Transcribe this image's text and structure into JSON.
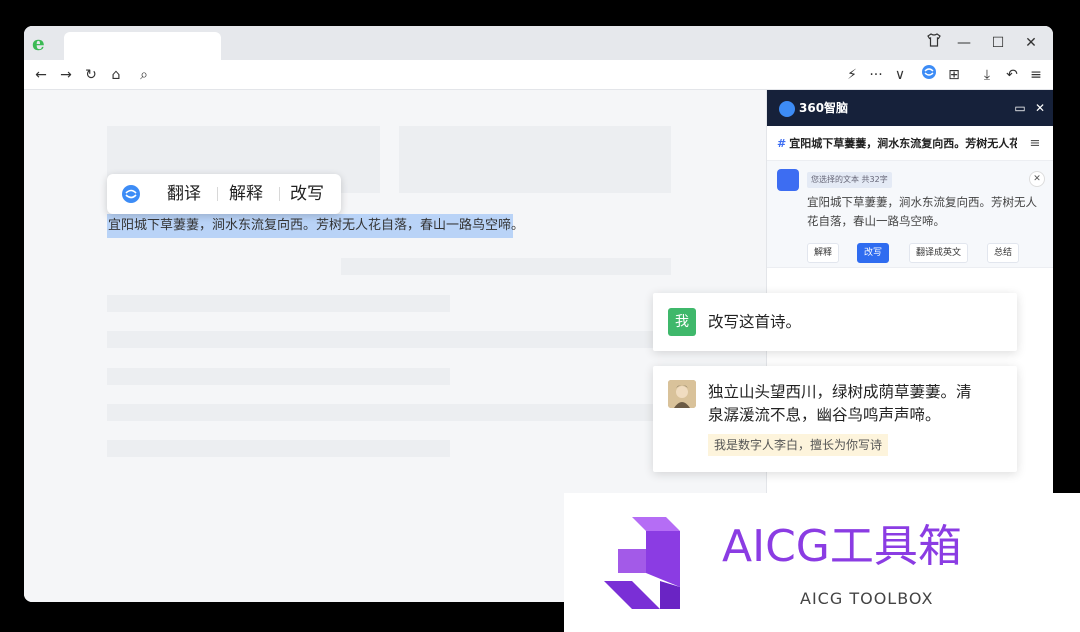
{
  "browser": {
    "tab_title": "",
    "controls": {
      "skin_icon": "shirt-icon",
      "minimize": "—",
      "maximize": "☐",
      "close": "✕"
    }
  },
  "toolbar": {
    "back": "←",
    "forward": "→",
    "reload": "↻",
    "home": "⌂",
    "search": "⌕",
    "flash": "⚡",
    "more": "···",
    "dropdown": "∨",
    "apps": "⊞",
    "download": "⤓",
    "undo": "↶",
    "menu": "≡"
  },
  "page": {
    "selected_text": "宜阳城下草萋萋，涧水东流复向西。芳树无人花自落，春山一路鸟空啼。",
    "popup": {
      "translate": "翻译",
      "explain": "解释",
      "rewrite": "改写"
    }
  },
  "sidebar": {
    "brand": "360智脑",
    "title": "宜阳城下草萋萋，涧水东流复向西。芳树无人花...",
    "card": {
      "chip": "您选择的文本  共32字",
      "text": "宜阳城下草萋萋，涧水东流复向西。芳树无人花自落，春山一路鸟空啼。",
      "actions": [
        "解释",
        "改写",
        "翻译成英文",
        "总结"
      ],
      "active_action": "改写"
    }
  },
  "chat": {
    "user_avatar": "我",
    "user_message": "改写这首诗。",
    "reply_line1": "独立山头望西川，绿树成荫草萋萋。清",
    "reply_line2": "泉潺湲流不息，幽谷鸟鸣声声啼。",
    "reply_hint": "我是数字人李白，擅长为你写诗"
  },
  "watermark": {
    "title": "AICG工具箱",
    "subtitle": "AICG TOOLBOX",
    "color": "#8b3ce3"
  }
}
